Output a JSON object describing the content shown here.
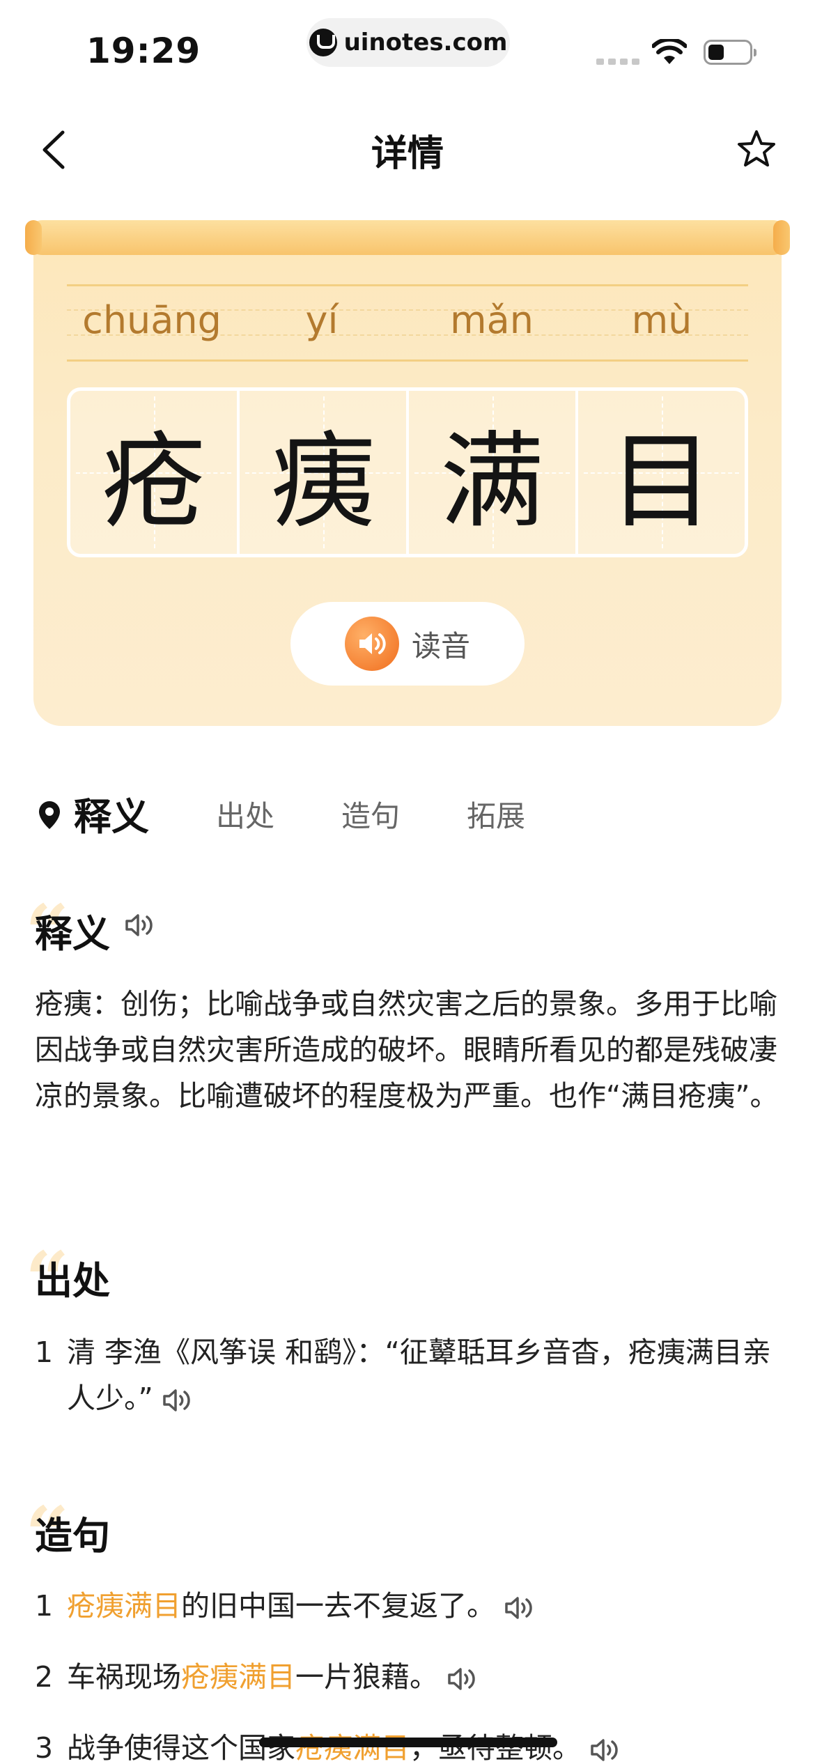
{
  "status_bar": {
    "time": "19:29",
    "url": "uinotes.com"
  },
  "nav": {
    "title": "详情"
  },
  "idiom": {
    "pinyin": [
      "chuāng",
      "yí",
      "mǎn",
      "mù"
    ],
    "chars": [
      "疮",
      "痍",
      "满",
      "目"
    ],
    "read_label": "读音"
  },
  "tabs": [
    "释义",
    "出处",
    "造句",
    "拓展"
  ],
  "meaning": {
    "title": "释义",
    "text": "疮痍：创伤；比喻战争或自然灾害之后的景象。多用于比喻因战争或自然灾害所造成的破坏。眼睛所看见的都是残破凄凉的景象。比喻遭破坏的程度极为严重。也作“满目疮痍”。"
  },
  "source": {
    "title": "出处",
    "items": [
      {
        "num": "1",
        "text": "清 李渔《风筝误 和鹞》：“征鼙聒耳乡音杳，疮痍满目亲人少。”"
      }
    ]
  },
  "examples": {
    "title": "造句",
    "items": [
      {
        "num": "1",
        "pre": "",
        "hl": "疮痍满目",
        "post": "的旧中国一去不复返了。"
      },
      {
        "num": "2",
        "pre": "车祸现场",
        "hl": "疮痍满目",
        "post": "一片狼藉。"
      },
      {
        "num": "3",
        "pre": "战争使得这个国家",
        "hl": "疮痍满目",
        "post": "，亟待整顿。"
      }
    ]
  },
  "colors": {
    "highlight": "#f0a030",
    "scroll_bg": "#fce9c4",
    "pinyin": "#b37a2e"
  }
}
